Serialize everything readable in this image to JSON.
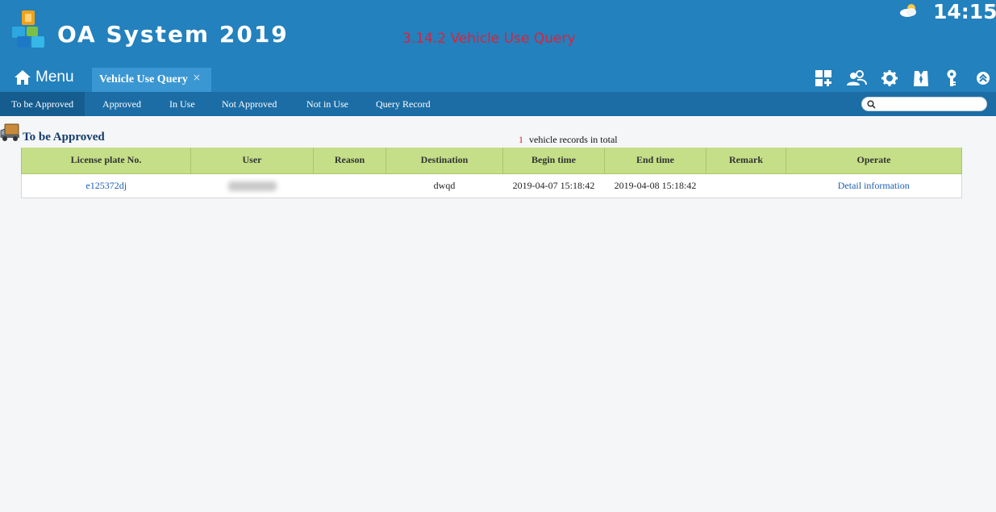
{
  "header": {
    "app_title": "OA System 2019",
    "overlay_caption": "3.14.2 Vehicle Use Query",
    "clock": "14:15",
    "weather_icon": "partly-cloudy-icon",
    "colors": {
      "header_bg": "#2381bd",
      "subnav_bg": "#1c6da5",
      "caption": "#e0203a"
    }
  },
  "tabs": {
    "menu_label": "Menu",
    "active_page_tab": "Vehicle Use Query",
    "close_glyph": "×"
  },
  "toolbar_icons": [
    "grid-add-icon",
    "users-icon",
    "gear-icon",
    "shirt-icon",
    "key-icon",
    "collapse-up-icon"
  ],
  "subnav": {
    "items": [
      "To be Approved",
      "Approved",
      "In Use",
      "Not Approved",
      "Not in Use",
      "Query Record"
    ],
    "active_index": 0,
    "search_placeholder": ""
  },
  "section": {
    "title": "To be Approved",
    "record_count": "1",
    "record_suffix": "vehicle records in total"
  },
  "table": {
    "columns": [
      "License plate No.",
      "User",
      "Reason",
      "Destination",
      "Begin time",
      "End time",
      "Remark",
      "Operate"
    ],
    "rows": [
      {
        "license_plate": "e125372dj",
        "user": "",
        "reason": "",
        "destination": "dwqd",
        "begin_time": "2019-04-07 15:18:42",
        "end_time": "2019-04-08 15:18:42",
        "remark": "",
        "operate": "Detail information"
      }
    ],
    "header_color": "#c5df88"
  }
}
